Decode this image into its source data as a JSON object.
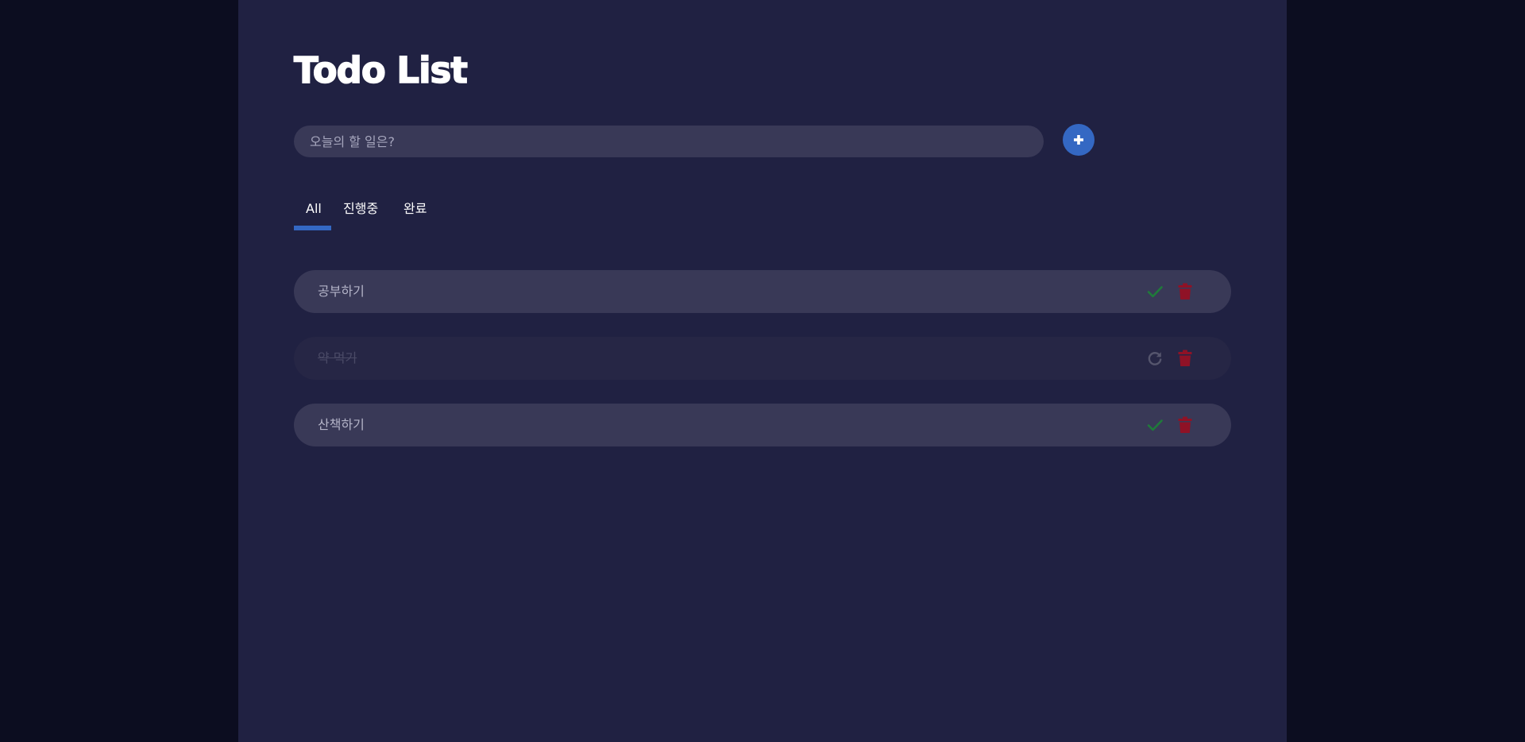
{
  "app": {
    "title": "Todo List"
  },
  "input": {
    "placeholder": "오늘의 할 일은?",
    "value": "",
    "add_icon": "plus-icon"
  },
  "tabs": [
    {
      "label": "All",
      "active": true
    },
    {
      "label": "진행중",
      "active": false
    },
    {
      "label": "완료",
      "active": false
    }
  ],
  "todos": [
    {
      "text": "공부하기",
      "done": false,
      "toggle_icon": "check-icon",
      "delete_icon": "trash-icon"
    },
    {
      "text": "약 먹기",
      "done": true,
      "toggle_icon": "undo-icon",
      "delete_icon": "trash-icon"
    },
    {
      "text": "산책하기",
      "done": false,
      "toggle_icon": "check-icon",
      "delete_icon": "trash-icon"
    }
  ],
  "colors": {
    "background": "#0c0d20",
    "panel": "#202142",
    "accent": "#3468c3",
    "item": "#393957",
    "item_done": "#262645",
    "check": "#1f7a3a",
    "delete": "#8f1226",
    "undo": "#55556d"
  }
}
